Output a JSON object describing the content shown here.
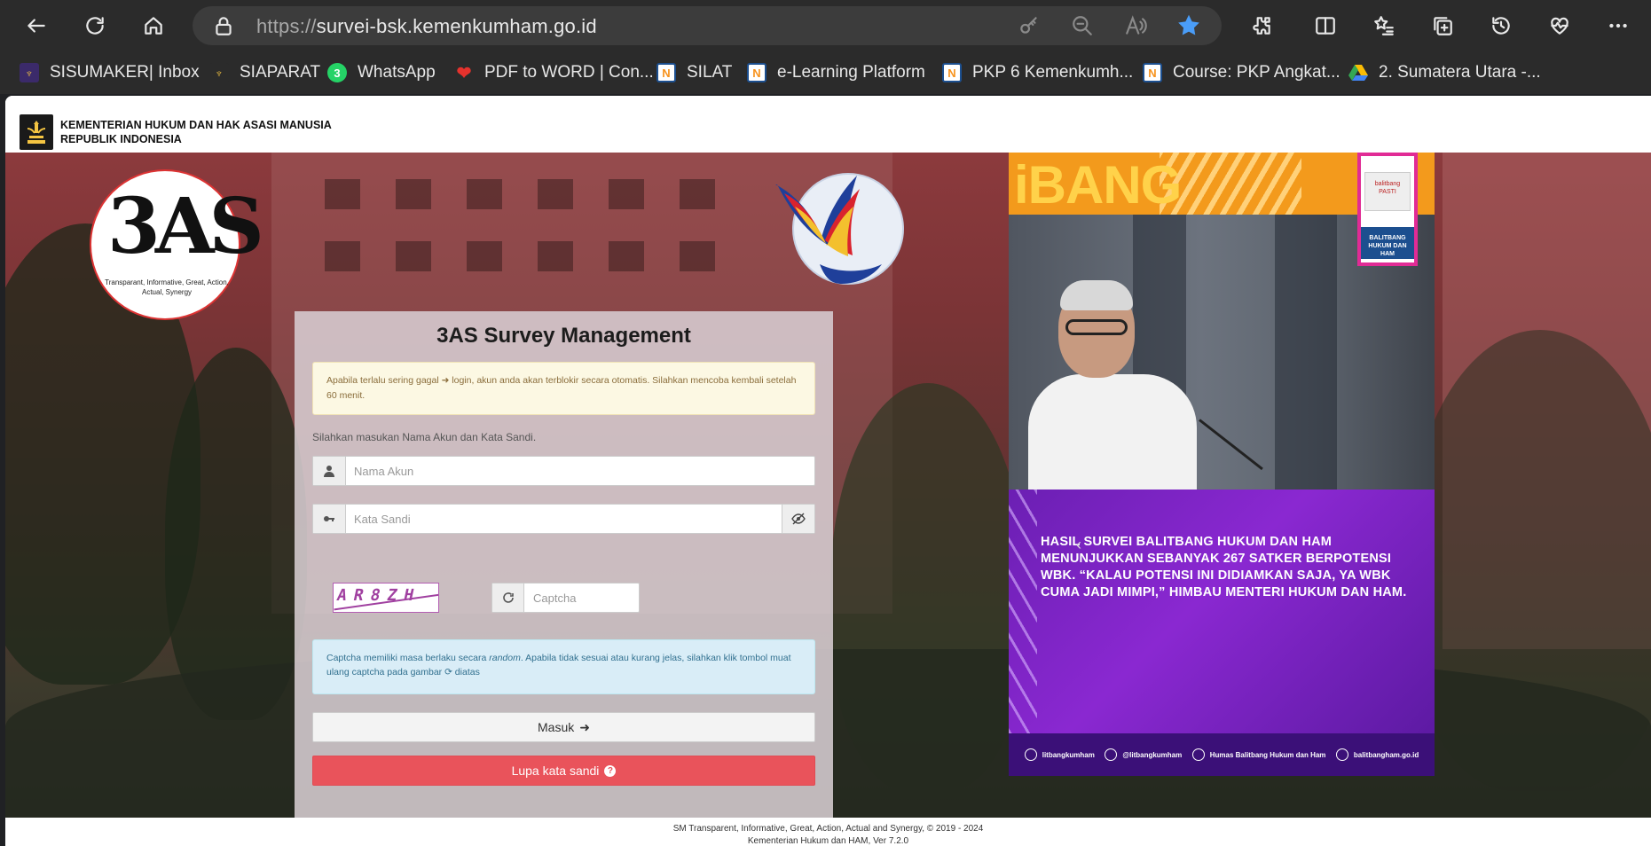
{
  "browser": {
    "url_scheme": "https://",
    "url_host": "survei-bsk.kemenkumham.go.id",
    "accent": "#4a9df8"
  },
  "bookmarks": [
    {
      "label": "SISUMAKER| Inbox",
      "icon": "emblem-icon"
    },
    {
      "label": "SIAPARAT",
      "icon": "emblem-icon"
    },
    {
      "label": "WhatsApp",
      "icon": "whatsapp-icon"
    },
    {
      "label": "PDF to WORD | Con...",
      "icon": "heart-icon"
    },
    {
      "label": "SILAT",
      "icon": "moodle-icon"
    },
    {
      "label": "e-Learning Platform",
      "icon": "moodle-icon"
    },
    {
      "label": "PKP 6 Kemenkumh...",
      "icon": "moodle-icon"
    },
    {
      "label": "Course: PKP Angkat...",
      "icon": "moodle-icon"
    },
    {
      "label": "2. Sumatera Utara -...",
      "icon": "google-drive-icon"
    }
  ],
  "ministry": {
    "line1": "KEMENTERIAN HUKUM DAN HAK ASASI MANUSIA",
    "line2": "REPUBLIK INDONESIA"
  },
  "logo_3as": {
    "mark": "3AS",
    "tagline": "Transparant, Informative, Great, Action, Actual, Synergy"
  },
  "login": {
    "title": "3AS Survey Management",
    "warning": "Apabila terlalu sering gagal ➜ login, akun anda akan terblokir secara otomatis. Silahkan mencoba kembali setelah 60 menit.",
    "hint": "Silahkan masukan Nama Akun dan Kata Sandi.",
    "username_placeholder": "Nama Akun",
    "password_placeholder": "Kata Sandi",
    "captcha_text": "AR8ZH",
    "captcha_placeholder": "Captcha",
    "info_prefix": "Captcha memiliki masa berlaku secara ",
    "info_em": "random",
    "info_suffix": ". Apabila tidak sesuai atau kurang jelas, silahkan klik tombol muat ulang captcha pada gambar ⟳ diatas",
    "submit_label": "Masuk",
    "forgot_label": "Lupa kata sandi",
    "forgot_color": "#e9535b"
  },
  "banner": {
    "brand": "iBANG",
    "logo_box_text": "balitbang PASTI",
    "logo_box_tag": "BALITBANG HUKUM DAN HAM",
    "headline": "HASIL SURVEI BALITBANG HUKUM DAN HAM MENUNJUKKAN SEBANYAK 267 SATKER BERPOTENSI WBK. “KALAU POTENSI INI DIDIAMKAN SAJA, YA WBK CUMA JADI MIMPI,” HIMBAU MENTERI HUKUM DAN HAM.",
    "social": [
      {
        "label": "litbangkumham",
        "icon": "instagram-icon"
      },
      {
        "label": "@litbangkumham",
        "icon": "twitter-icon"
      },
      {
        "label": "Humas Balitbang Hukum dan Ham",
        "icon": "facebook-icon"
      },
      {
        "label": "balitbangham.go.id",
        "icon": "globe-icon"
      }
    ]
  },
  "footer": {
    "line1": "SM Transparent, Informative, Great, Action, Actual and Synergy, © 2019 - 2024",
    "line2": "Kementerian Hukum dan HAM, Ver 7.2.0"
  }
}
